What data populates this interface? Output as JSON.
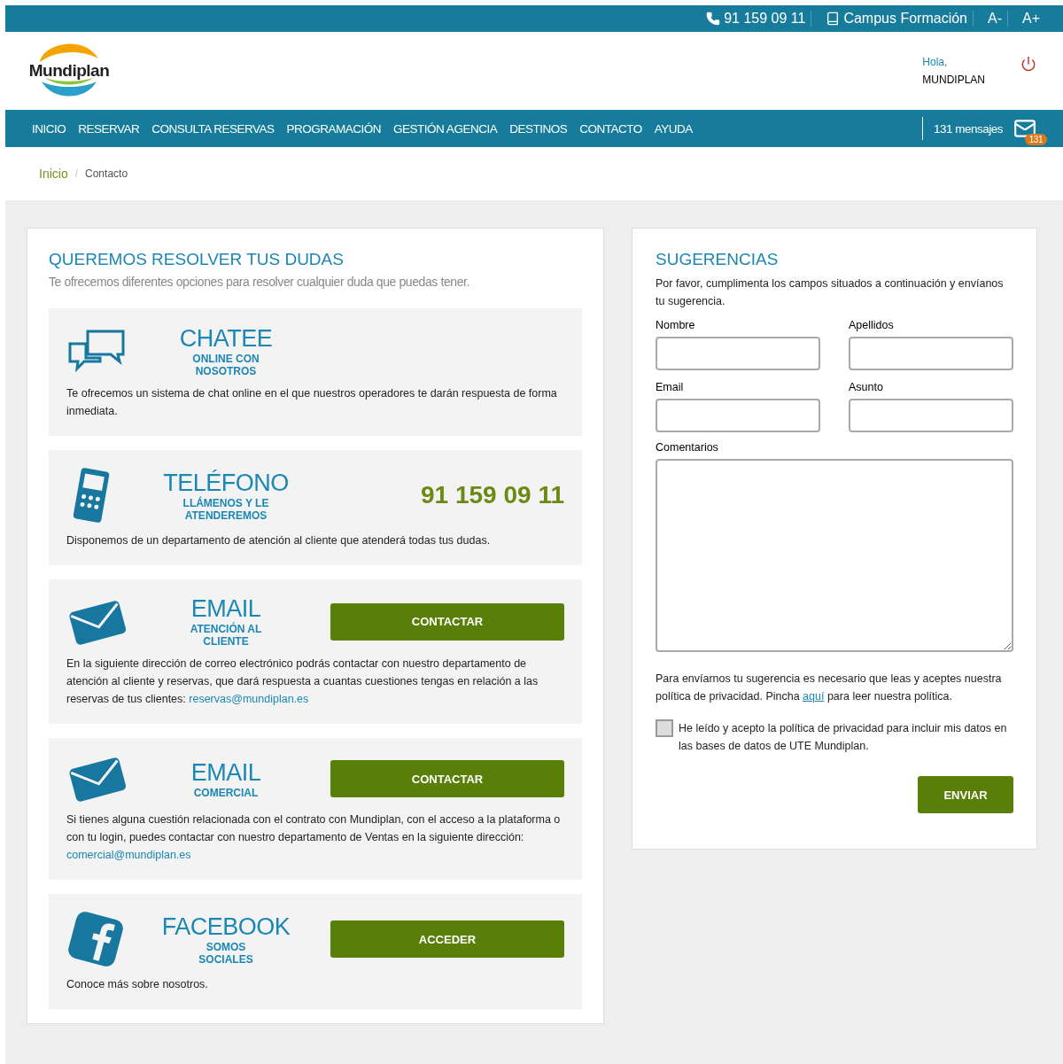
{
  "top_bar": {
    "phone": "91 159 09 11",
    "campus": "Campus Formación",
    "font_smaller": "A-",
    "font_larger": "A+"
  },
  "header": {
    "logo": "Mundiplan",
    "greeting": "Hola,",
    "user": "MUNDIPLAN"
  },
  "nav": {
    "items": [
      {
        "label": "INICIO",
        "selected": false
      },
      {
        "label": "RESERVAR",
        "selected": false
      },
      {
        "label": "CONSULTA RESERVAS",
        "selected": false
      },
      {
        "label": "PROGRAMACIÓN",
        "selected": false
      },
      {
        "label": "GESTIÓN AGENCIA",
        "selected": false
      },
      {
        "label": "DESTINOS",
        "selected": false
      },
      {
        "label": "CONTACTO",
        "selected": false
      },
      {
        "label": "AYUDA",
        "selected": false
      }
    ],
    "messages": "131 mensajes",
    "badge": "131"
  },
  "breadcrumb": {
    "separator": "/",
    "items": [
      {
        "label": "Inicio",
        "kind": "link"
      },
      {
        "label": "Contacto",
        "kind": "current"
      }
    ]
  },
  "help": {
    "title": "QUEREMOS RESOLVER TUS DUDAS",
    "subtitle": "Te ofrecemos diferentes opciones para resolver cualquier duda que puedas tener.",
    "cards": [
      {
        "kind": "chat",
        "title": "CHATEE",
        "subtitle": "ONLINE CON NOSOTROS",
        "text": "Te ofrecemos un sistema de chat online en el que nuestros operadores te darán respuesta de forma inmediata."
      },
      {
        "kind": "phone",
        "title": "TELÉFONO",
        "subtitle": "LLÁMENOS Y LE ATENDEREMOS",
        "number": "91 159 09 11",
        "text": "Disponemos de un departamento de atención al cliente que atenderá todas tus dudas."
      },
      {
        "kind": "email",
        "title": "EMAIL",
        "subtitle": "ATENCIÓN AL CLIENTE",
        "button": "CONTACTAR",
        "text": "En la siguiente dirección de correo electrónico podrás contactar con nuestro departamento de atención al cliente y reservas, que dará respuesta a cuantas cuestiones tengas en relación a las reservas de tus clientes:",
        "link": "reservas@mundiplan.es"
      },
      {
        "kind": "email",
        "title": "EMAIL",
        "subtitle": "COMERCIAL",
        "button": "CONTACTAR",
        "text": "Si tienes alguna cuestión relacionada con el contrato con Mundiplan, con el acceso a la plataforma o con tu login, puedes contactar con nuestro departamento de Ventas en la siguiente dirección:",
        "link": "comercial@mundiplan.es"
      },
      {
        "kind": "facebook",
        "title": "FACEBOOK",
        "subtitle": "SOMOS SOCIALES",
        "button": "ACCEDER",
        "text": "Conoce más sobre nosotros."
      }
    ]
  },
  "suggestions": {
    "title": "SUGERENCIAS",
    "intro": "Por favor, cumplimenta los campos situados a continuación y envíanos tu sugerencia.",
    "fields": [
      {
        "label": "Nombre"
      },
      {
        "label": "Apellidos"
      },
      {
        "label": "Email"
      },
      {
        "label": "Asunto"
      }
    ],
    "comments_label": "Comentarios",
    "privacy_before": "Para envíarnos tu sugerencia es necesario que leas y aceptes nuestra política de privacidad. Pincha",
    "privacy_link": "aquí",
    "privacy_after": "para leer nuestra política.",
    "consent": {
      "label": "He leído y acepto la política de privacidad para incluir mis datos en las bases de datos de UTE Mundiplan.",
      "checked": false
    },
    "submit": "ENVIAR"
  }
}
